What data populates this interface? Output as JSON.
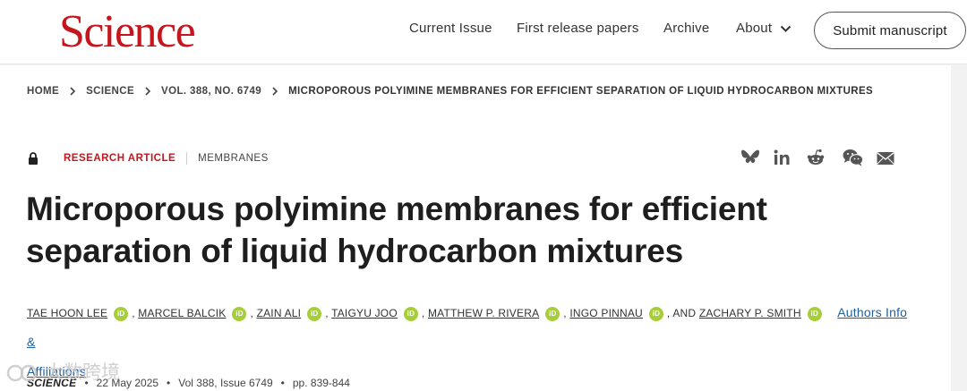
{
  "header": {
    "logo": "Science",
    "nav": [
      {
        "label": "Current Issue"
      },
      {
        "label": "First release papers"
      },
      {
        "label": "Archive"
      },
      {
        "label": "About"
      }
    ],
    "submit_label": "Submit manuscript"
  },
  "breadcrumb": [
    "HOME",
    "SCIENCE",
    "VOL. 388, NO. 6749",
    "MICROPOROUS POLYIMINE MEMBRANES FOR EFFICIENT SEPARATION OF LIQUID HYDROCARBON MIXTURES"
  ],
  "article": {
    "type": "RESEARCH ARTICLE",
    "subject": "MEMBRANES",
    "title_line1": "Microporous polyimine membranes for efficient",
    "title_line2": "separation of liquid hydrocarbon mixtures",
    "authors": [
      "TAE HOON LEE",
      "MARCEL BALCIK",
      "ZAIN ALI",
      "TAIGYU JOO",
      "MATTHEW P. RIVERA",
      "INGO PINNAU",
      "ZACHARY P. SMITH"
    ],
    "orcid_label": "iD",
    "and_label": ", AND",
    "authors_link": "Authors Info &",
    "affiliations_link": "Affiliations",
    "journal": "SCIENCE",
    "date": "22 May 2025",
    "volume": "Vol 388, Issue 6749",
    "pages": "pp. 839-844"
  },
  "share_icons": [
    "bluesky-icon",
    "linkedin-icon",
    "reddit-icon",
    "wechat-icon",
    "email-icon"
  ],
  "colors": {
    "brand": "#c4161c",
    "link": "#1f5f9e",
    "orcid": "#a6ce39"
  },
  "watermark": "大数跨境"
}
